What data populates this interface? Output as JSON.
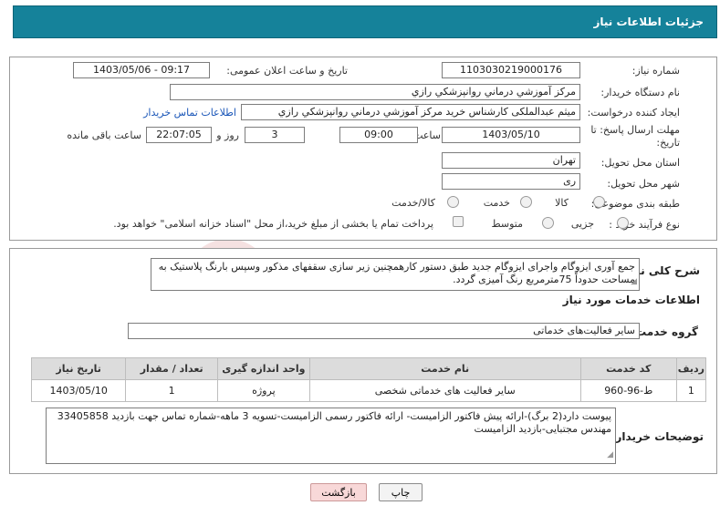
{
  "header": {
    "title": "جزئیات اطلاعات نیاز"
  },
  "form": {
    "need_number": {
      "label": "شماره نیاز:",
      "value": "1103030219000176"
    },
    "announce_datetime": {
      "label": "تاریخ و ساعت اعلان عمومی:",
      "value": "1403/05/06 - 09:17"
    },
    "buyer_org": {
      "label": "نام دستگاه خریدار:",
      "value": "مرکز آموزشي درماني روانپزشکي رازي"
    },
    "requester": {
      "label": "ایجاد کننده درخواست:",
      "value": "میثم عبدالملکی کارشناس خرید مرکز آموزشي درماني روانپزشکي رازي",
      "contact_link": "اطلاعات تماس خریدار"
    },
    "deadline": {
      "label": "مهلت ارسال پاسخ: تا تاریخ:",
      "date": "1403/05/10",
      "time_label": "ساعت",
      "time": "09:00",
      "days": "3",
      "days_label": "روز و",
      "remaining": "22:07:05",
      "remaining_label": "ساعت باقی مانده"
    },
    "province": {
      "label": "استان محل تحویل:",
      "value": "تهران"
    },
    "city": {
      "label": "شهر محل تحویل:",
      "value": "ری"
    },
    "category": {
      "label": "طبقه بندی موضوعی:",
      "options": [
        "کالا",
        "خدمت",
        "کالا/خدمت"
      ]
    },
    "process": {
      "label": "نوع فرآیند خرید :",
      "options": [
        "جزیی",
        "متوسط"
      ],
      "payment_note": "پرداخت تمام یا بخشی از مبلغ خرید،از محل \"اسناد خزانه اسلامی\" خواهد بود."
    }
  },
  "summary": {
    "label": "شرح کلی نیاز:",
    "text": "جمع آوری ایزوگام واجرای ایزوگام جدید طبق دستور کارهمچنین زیر سازی سقفهای مذکور وسپس بارنگ پلاستیک به مساحت حدوداً 75مترمربع رنگ آمیزی گردد."
  },
  "services": {
    "section_title": "اطلاعات خدمات مورد نیاز",
    "group_label": "گروه خدمت:",
    "group_value": "سایر فعالیت‌های خدماتی",
    "columns": [
      "ردیف",
      "کد خدمت",
      "نام خدمت",
      "واحد اندازه گیری",
      "تعداد / مقدار",
      "تاریخ نیاز"
    ],
    "rows": [
      [
        "1",
        "ط-96-960",
        "سایر فعالیت های خدماتی شخصی",
        "پروژه",
        "1",
        "1403/05/10"
      ]
    ]
  },
  "buyer_notes": {
    "label": "توضیحات خریدار:",
    "text": "پیوست دارد(2 برگ)-ارائه پیش فاکتور الزامیست- ارائه فاکتور رسمی الزامیست-تسویه 3 ماهه-شماره تماس جهت بازدید 33405858 مهندس مجتبایی-بازدید الزامیست"
  },
  "buttons": {
    "print": "چاپ",
    "back": "بازگشت"
  },
  "watermark": {
    "text": "AriaTender.neT"
  },
  "colors": {
    "header_bg": "#15829a",
    "link": "#1a56b8",
    "back_button_bg": "#f8d8d8"
  }
}
